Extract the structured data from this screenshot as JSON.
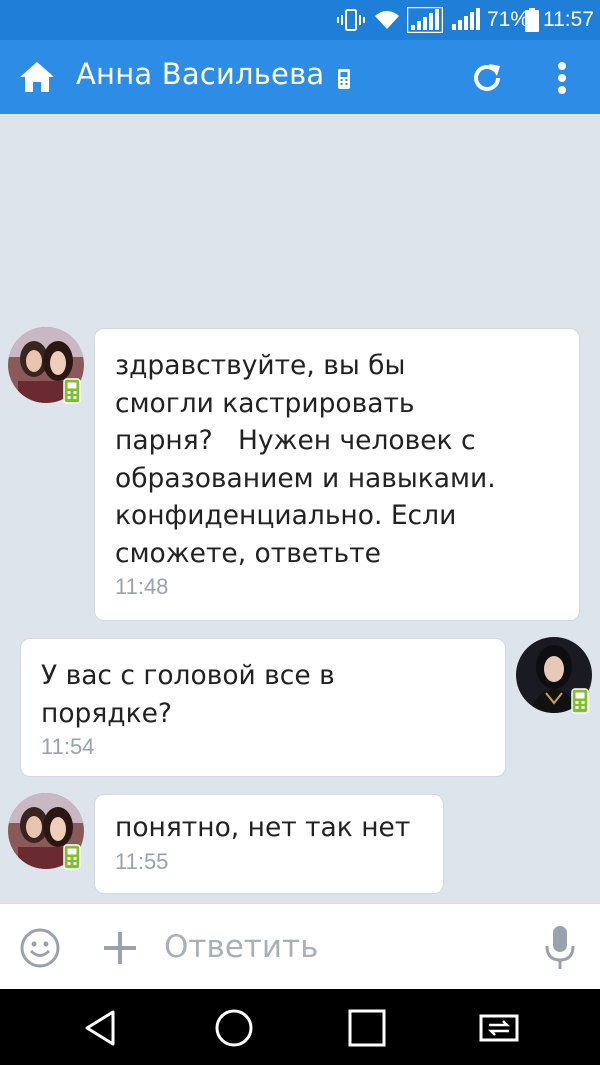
{
  "status_bar": {
    "battery_percent": "71%",
    "time": "11:57",
    "icons": [
      "vibrate-icon",
      "wifi-icon",
      "signal-icon",
      "signal-icon-2",
      "battery-icon"
    ]
  },
  "app_bar": {
    "title": "Анна Васильева",
    "icons": [
      "home-icon",
      "mobile-phone-icon",
      "refresh-icon",
      "more-vert-icon"
    ]
  },
  "messages": [
    {
      "direction": "incoming",
      "text_lines": [
        "здравствуйте, вы бы",
        "смогли кастрировать",
        "парня?   Нужен человек с",
        "образованием и навыками.",
        "конфиденциально. Если",
        "сможете, ответьте"
      ],
      "time": "11:48"
    },
    {
      "direction": "outgoing",
      "text_lines": [
        "У вас с головой все в",
        "порядке?"
      ],
      "time": "11:54"
    },
    {
      "direction": "incoming",
      "text_lines": [
        "понятно, нет так нет"
      ],
      "time": "11:55"
    }
  ],
  "composer": {
    "placeholder": "Ответить",
    "icons": [
      "emoji-icon",
      "plus-icon",
      "microphone-icon"
    ]
  },
  "nav_bar": {
    "icons": [
      "back-icon",
      "home-circle-icon",
      "recents-icon",
      "switch-sim-icon"
    ]
  },
  "colors": {
    "status_bar": "#1f7fd8",
    "app_bar": "#2d8de6",
    "chat_background": "#dde4ec",
    "bubble": "#ffffff",
    "time_text": "#9aa3ad",
    "mobile_badge": "#7cc02e"
  }
}
